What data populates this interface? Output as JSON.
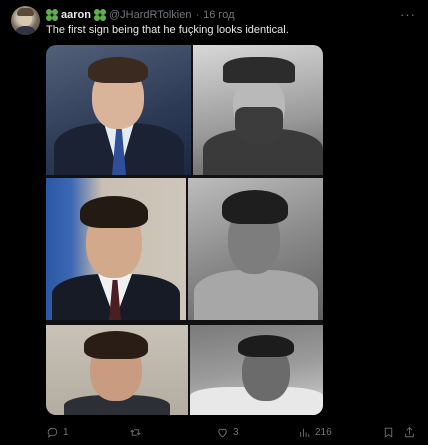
{
  "tweet": {
    "display_name": "aaron",
    "handle": "@JHardRTolkien",
    "separator": "·",
    "time": "16 год",
    "text": "The first sign being that he fuçking looks identical.",
    "more_label": "···"
  },
  "icons": {
    "name_emoji_left": "four-leaf-clover-icon",
    "name_emoji_right": "four-leaf-clover-icon",
    "reply": "reply-icon",
    "retweet": "retweet-icon",
    "like": "heart-icon",
    "views": "views-icon",
    "bookmark": "bookmark-icon",
    "share": "share-icon"
  },
  "actions": {
    "replies": "1",
    "retweets": "",
    "likes": "3",
    "views": "216"
  },
  "colors": {
    "background": "#000000",
    "text_primary": "#e7e9ea",
    "text_secondary": "#71767b",
    "clover": "#5fb04a"
  }
}
